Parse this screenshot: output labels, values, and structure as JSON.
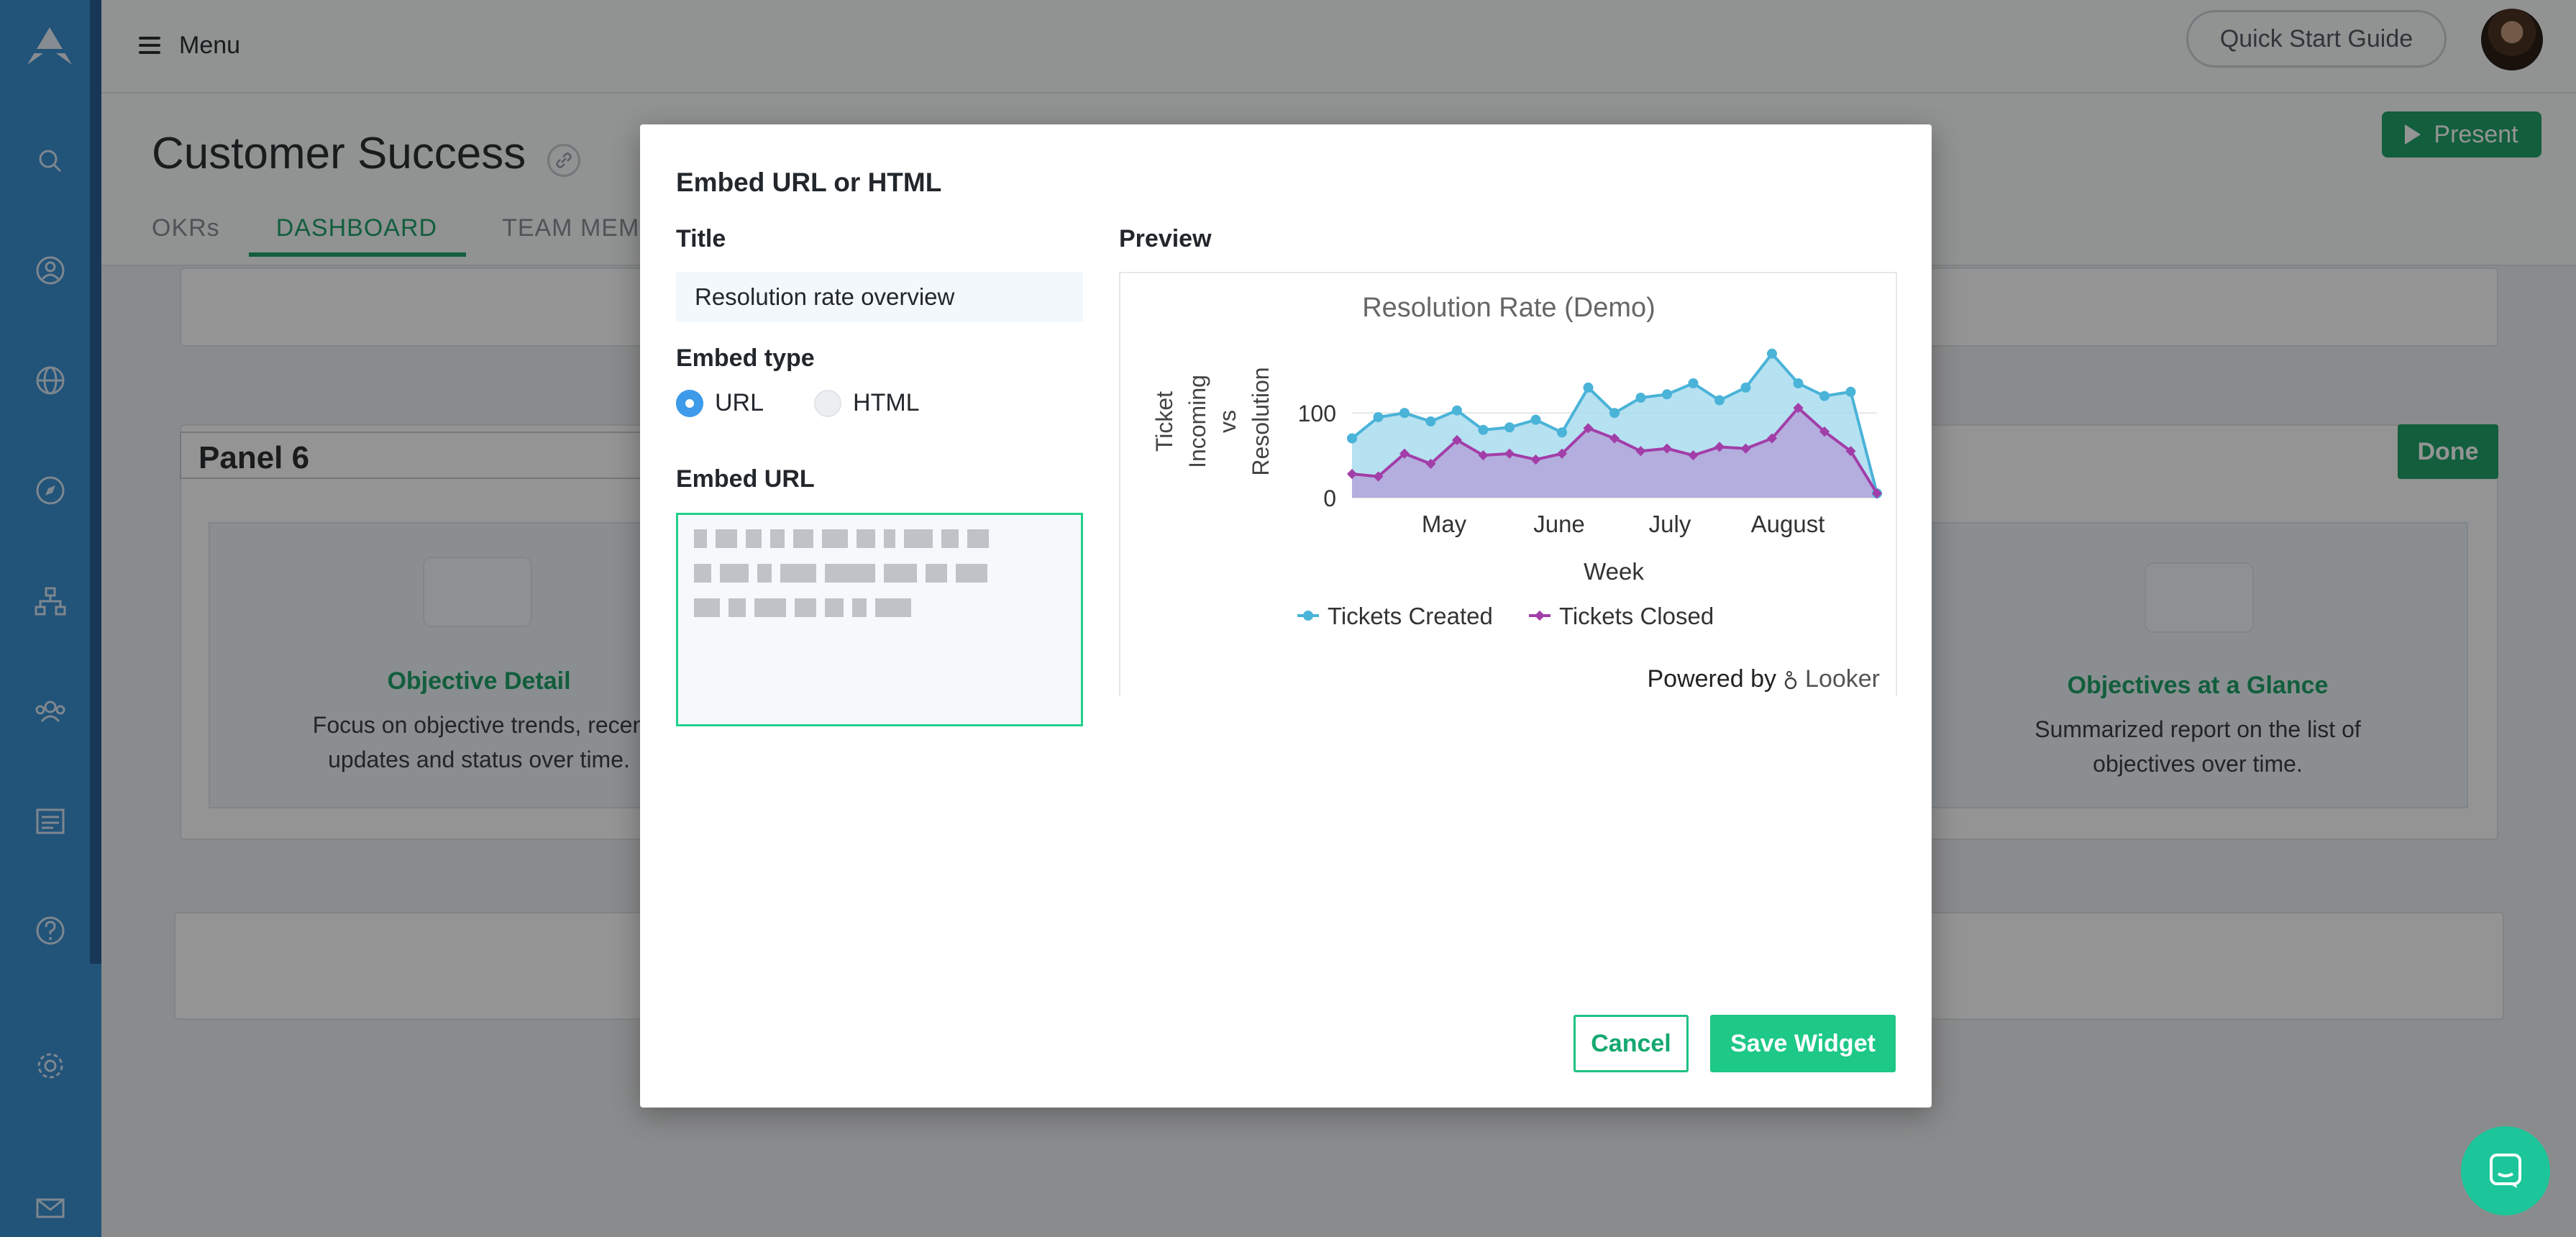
{
  "topbar": {
    "menu_label": "Menu",
    "quick_start_label": "Quick Start Guide"
  },
  "page": {
    "title": "Customer Success",
    "tabs": [
      {
        "label": "OKRs",
        "active": false
      },
      {
        "label": "DASHBOARD",
        "active": true
      },
      {
        "label": "TEAM MEMB",
        "active": false
      }
    ],
    "present_label": "Present"
  },
  "dashboard": {
    "panel_title": "Panel 6",
    "done_label": "Done",
    "tiles": [
      {
        "title": "Objective Detail",
        "desc_line1": "Focus on objective trends, recen",
        "desc_line2": "updates and status over time."
      },
      {
        "title": "Objectives at a Glance",
        "desc_line1": "Summarized report on the list of",
        "desc_line2": "objectives over time."
      }
    ]
  },
  "modal": {
    "title": "Embed URL or HTML",
    "title_label": "Title",
    "title_value": "Resolution rate overview",
    "embed_type_label": "Embed type",
    "embed_types": [
      {
        "label": "URL",
        "selected": true
      },
      {
        "label": "HTML",
        "selected": false
      }
    ],
    "embed_url_label": "Embed URL",
    "preview_label": "Preview",
    "powered_by": "Powered by",
    "looker": "Looker",
    "cancel_label": "Cancel",
    "save_label": "Save Widget"
  },
  "chart_data": {
    "type": "area",
    "title": "Resolution Rate (Demo)",
    "xlabel": "Week",
    "ylabel_lines": [
      "Ticket",
      "Incoming",
      "vs",
      "Resolution"
    ],
    "x_tick_labels": [
      "May",
      "June",
      "July",
      "August"
    ],
    "y_ticks": [
      0,
      100
    ],
    "ylim": [
      0,
      180
    ],
    "legend_position": "bottom",
    "colors": {
      "created": "#4ab3d8",
      "created_fill": "#a9dcef",
      "closed": "#a23ea8",
      "closed_fill": "#b4a9dc"
    },
    "series": [
      {
        "name": "Tickets Created",
        "values": [
          70,
          95,
          100,
          90,
          103,
          80,
          83,
          92,
          77,
          130,
          100,
          118,
          122,
          135,
          115,
          130,
          170,
          135,
          120,
          125,
          5
        ]
      },
      {
        "name": "Tickets Closed",
        "values": [
          28,
          25,
          52,
          40,
          68,
          50,
          52,
          45,
          52,
          82,
          70,
          55,
          58,
          50,
          60,
          58,
          70,
          106,
          78,
          55,
          5
        ]
      }
    ]
  }
}
